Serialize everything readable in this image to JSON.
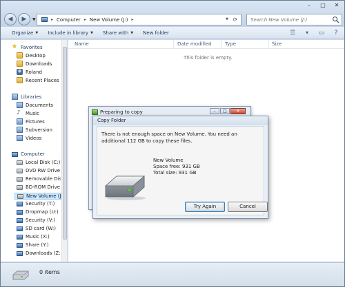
{
  "window": {
    "controls": {
      "minimize": "–",
      "maximize": "□",
      "close": "✕"
    }
  },
  "address": {
    "segments": [
      "Computer",
      "New Volume (J:)"
    ],
    "separator": "▸"
  },
  "search": {
    "placeholder": "Search New Volume (J:)"
  },
  "toolbar": {
    "organize": "Organize",
    "include_in_library": "Include in library",
    "share_with": "Share with",
    "new_folder": "New folder"
  },
  "sidebar": {
    "favorites_label": "Favorites",
    "favorites": [
      {
        "label": "Desktop",
        "icon": "folder-icon"
      },
      {
        "label": "Downloads",
        "icon": "folder-icon"
      },
      {
        "label": "Roland",
        "icon": "user-icon"
      },
      {
        "label": "Recent Places",
        "icon": "folder-icon"
      }
    ],
    "libraries_label": "Libraries",
    "libraries": [
      {
        "label": "Documents",
        "icon": "library-icon"
      },
      {
        "label": "Music",
        "icon": "music-icon"
      },
      {
        "label": "Pictures",
        "icon": "library-icon"
      },
      {
        "label": "Subversion",
        "icon": "library-icon"
      },
      {
        "label": "Videos",
        "icon": "library-icon"
      }
    ],
    "computer_label": "Computer",
    "drives": [
      {
        "label": "Local Disk (C:)"
      },
      {
        "label": "DVD RW Drive (D"
      },
      {
        "label": "Removable Disk ("
      },
      {
        "label": "BD-ROM Drive (I:"
      },
      {
        "label": "New Volume (J:)"
      },
      {
        "label": "Security (T:)"
      },
      {
        "label": "Dropmap (U:)"
      },
      {
        "label": "Security (V:)"
      },
      {
        "label": "SD card (W:)"
      },
      {
        "label": "Music (X:)"
      },
      {
        "label": "Share (Y:)"
      },
      {
        "label": "Downloads (Z:)"
      }
    ],
    "selected_drive": "New Volume (J:)"
  },
  "columns": [
    "Name",
    "Date modified",
    "Type",
    "Size"
  ],
  "content": {
    "empty_message": "This folder is empty."
  },
  "status": {
    "item_count": "0 items"
  },
  "dialog_back": {
    "title": "Preparing to copy"
  },
  "dialog": {
    "title": "Copy Folder",
    "message": "There is not enough space on New Volume. You need an additional 112 GB to copy these files.",
    "volume_name": "New Volume",
    "space_free": "Space free: 931 GB",
    "total_size": "Total size: 931 GB",
    "try_again": "Try Again",
    "cancel": "Cancel"
  }
}
